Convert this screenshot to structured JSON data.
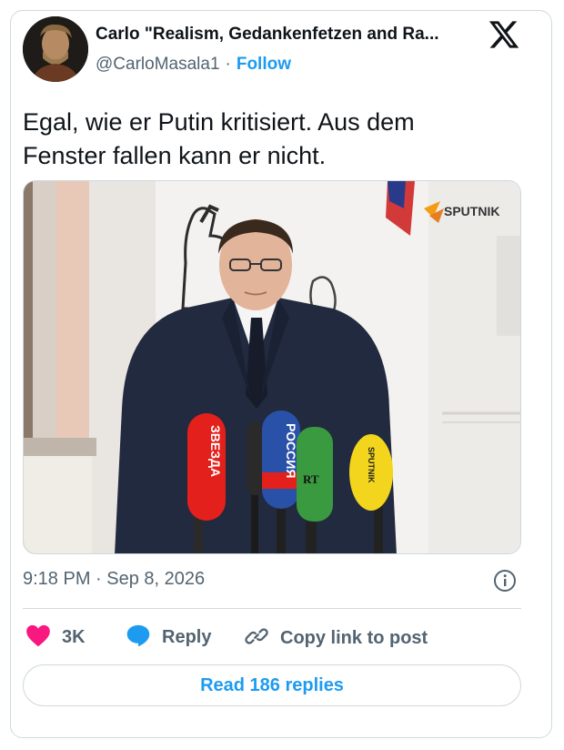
{
  "author": {
    "display_name": "Carlo \"Realism, Gedankenfetzen and Ra...",
    "handle": "@CarloMasala1",
    "separator": "·",
    "follow_label": "Follow"
  },
  "tweet": {
    "text_line1": "Egal, wie er Putin kritisiert. Aus dem",
    "text_line2": "Fenster fallen kann er nicht."
  },
  "media": {
    "watermark": "SPUTNIK",
    "mic_labels": [
      "ЗВЕЗДА",
      "РОССИЯ",
      "RT",
      "SPUTNIK"
    ]
  },
  "meta": {
    "timestamp": "9:18 PM · Sep 8, 2026"
  },
  "actions": {
    "like_count": "3K",
    "reply_label": "Reply",
    "copy_link_label": "Copy link to post"
  },
  "footer": {
    "read_replies_label": "Read 186 replies"
  },
  "icons": [
    "x-logo-icon",
    "info-icon",
    "heart-icon",
    "reply-bubble-icon",
    "link-icon"
  ],
  "colors": {
    "link_blue": "#1d9bf0",
    "heart_pink": "#f91880",
    "muted_text": "#536471",
    "border": "#cfd9de"
  }
}
